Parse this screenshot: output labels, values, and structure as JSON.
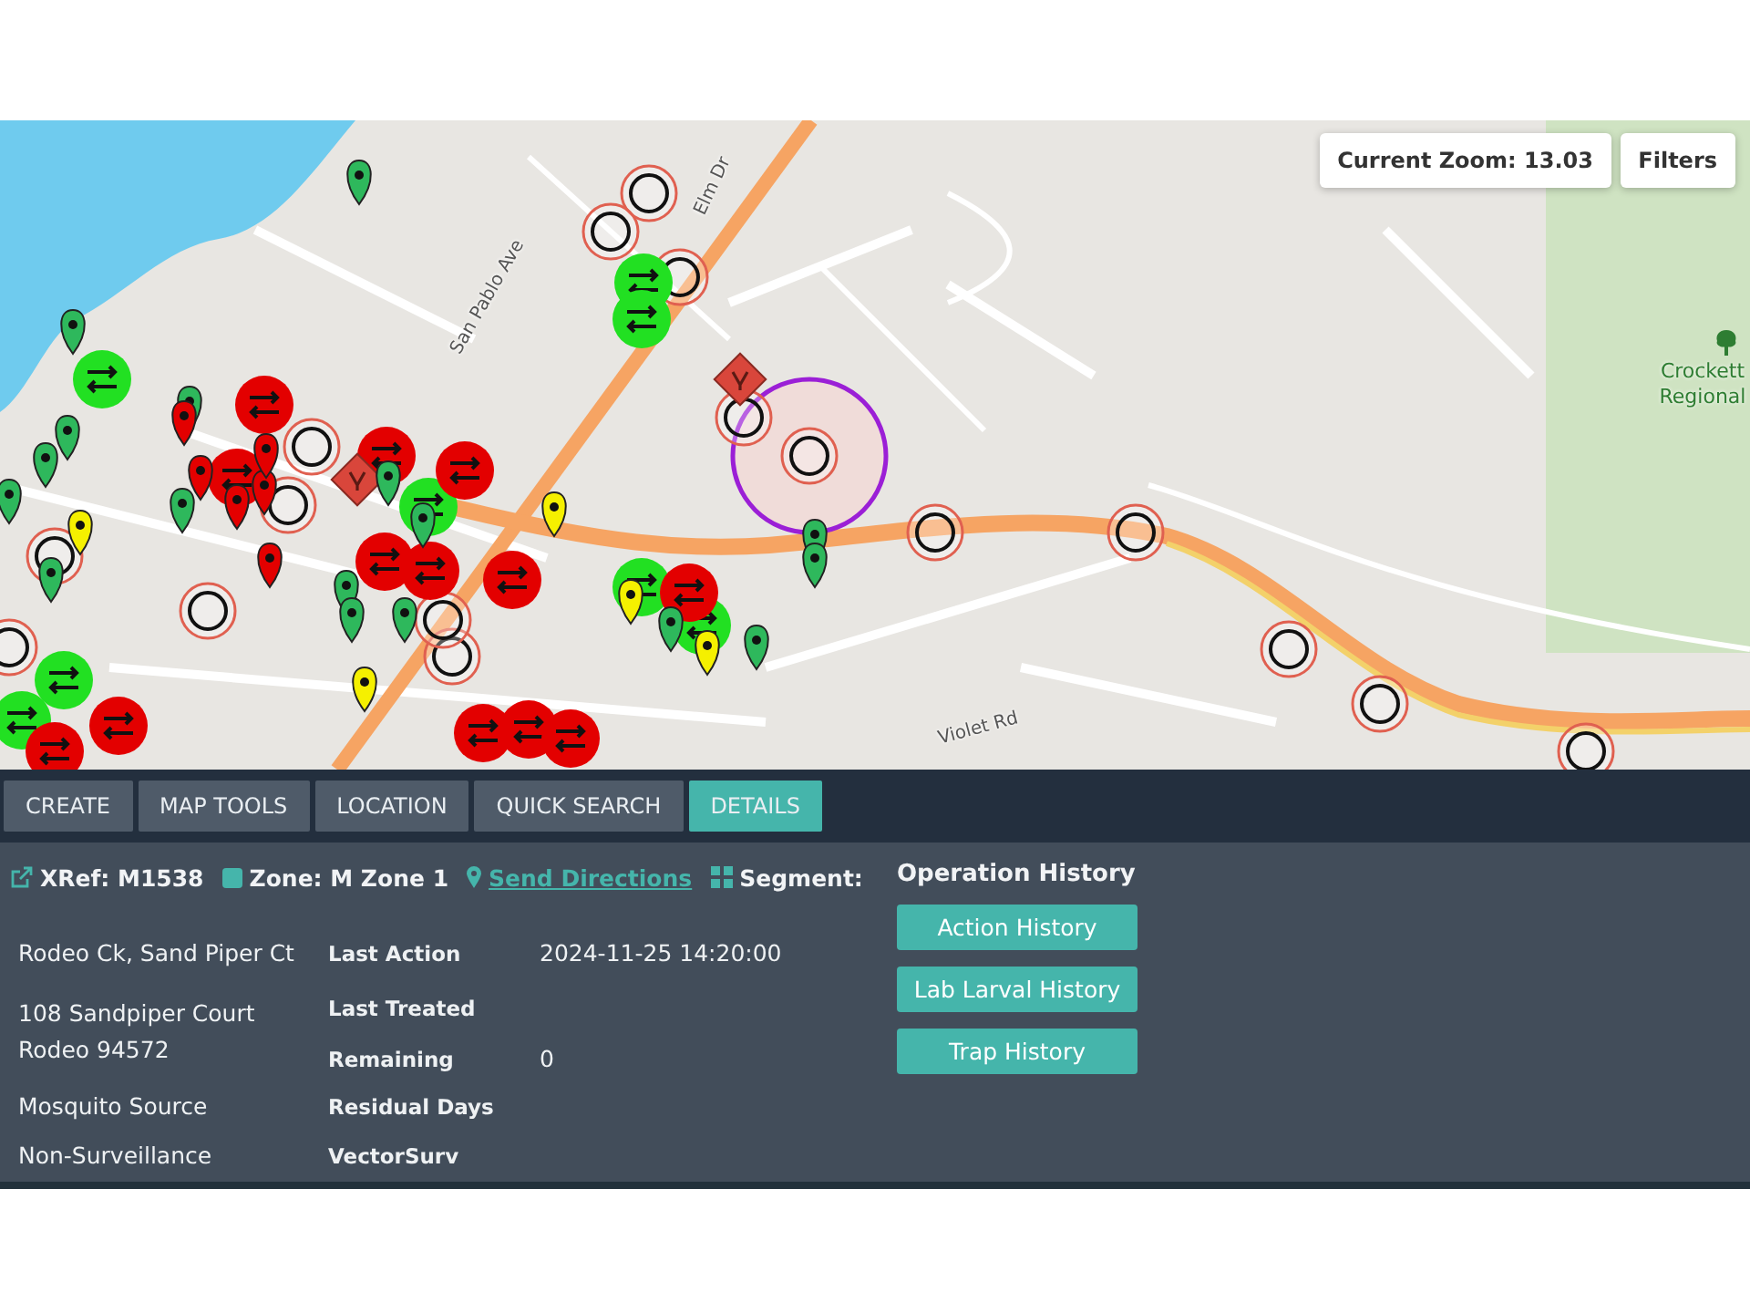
{
  "map": {
    "zoom_label": "Current Zoom: 13.03",
    "filters_button": "Filters",
    "street_labels": [
      {
        "text": "San Pablo Ave"
      },
      {
        "text": "Elm Dr"
      },
      {
        "text": "Violet Rd"
      }
    ],
    "park_label": "Crockett Regional"
  },
  "tabs": [
    {
      "label": "CREATE",
      "selected": false
    },
    {
      "label": "MAP TOOLS",
      "selected": false
    },
    {
      "label": "LOCATION",
      "selected": false
    },
    {
      "label": "QUICK SEARCH",
      "selected": false
    },
    {
      "label": "DETAILS",
      "selected": true
    }
  ],
  "details": {
    "header": {
      "xref": "XRef: M1538",
      "zone": "Zone: M Zone 1",
      "directions_link": "Send Directions",
      "segment": "Segment:"
    },
    "site_name": "Rodeo Ck, Sand Piper Ct",
    "address_lines": [
      "108 Sandpiper Court",
      "Rodeo 94572"
    ],
    "site_type": "Mosquito Source",
    "surveillance": "Non-Surveillance",
    "fields": [
      {
        "label": "Last Action",
        "value": "2024-11-25 14:20:00"
      },
      {
        "label": "Last Treated"
      },
      {
        "label": "Remaining",
        "value": "0"
      },
      {
        "label": "Residual Days"
      },
      {
        "label": "VectorSurv"
      }
    ],
    "operation_history": {
      "title": "Operation History",
      "buttons": [
        "Action History",
        "Lab Larval History",
        "Trap History"
      ]
    }
  }
}
